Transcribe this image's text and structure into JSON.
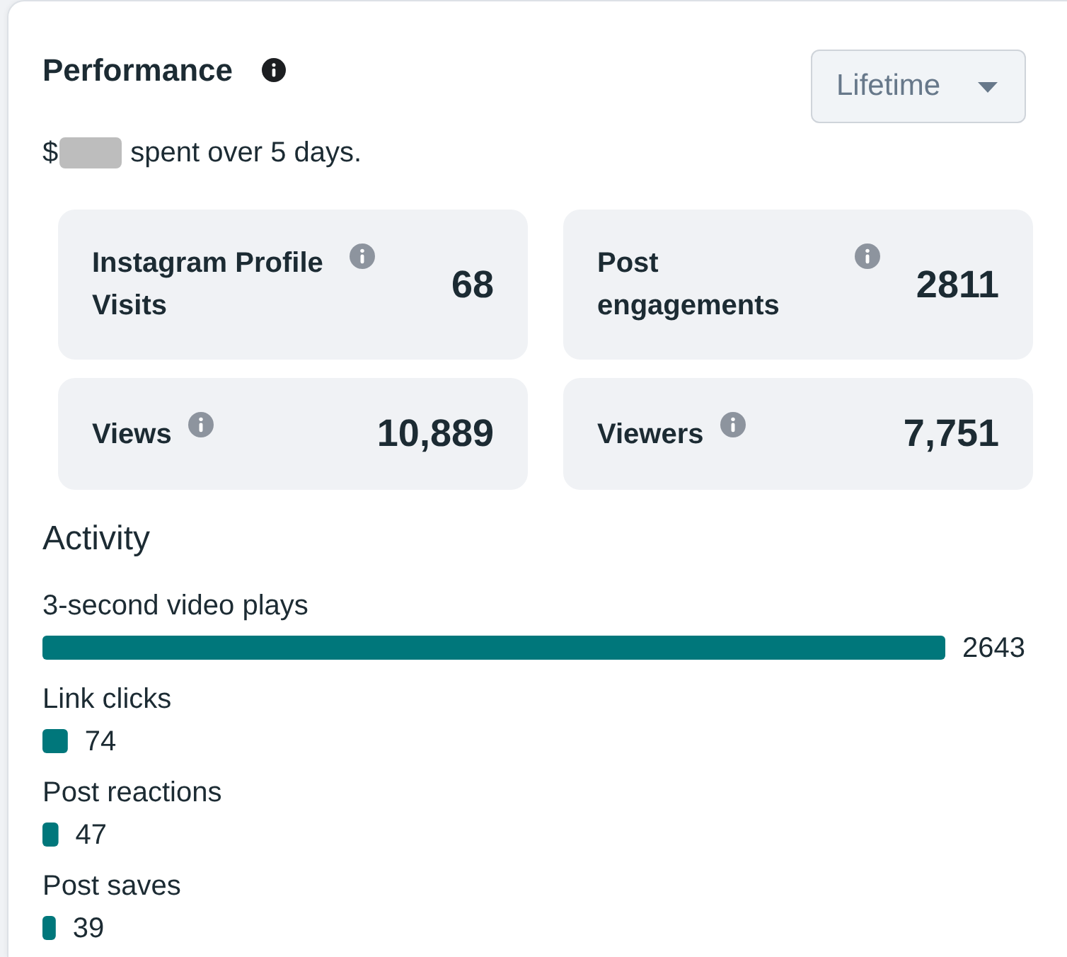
{
  "header": {
    "title": "Performance",
    "range_dropdown": {
      "value": "Lifetime"
    }
  },
  "spend_note": {
    "currency": "$",
    "amount_redacted": true,
    "text": "spent over 5 days."
  },
  "metrics": [
    {
      "label": "Instagram Profile Visits",
      "value": "68"
    },
    {
      "label": "Post engagements",
      "value": "2811"
    },
    {
      "label": "Views",
      "value": "10,889"
    },
    {
      "label": "Viewers",
      "value": "7,751"
    }
  ],
  "activity": {
    "chart_data": {
      "type": "bar",
      "orientation": "horizontal",
      "title": "Activity",
      "categories": [
        "3-second video plays",
        "Link clicks",
        "Post reactions",
        "Post saves"
      ],
      "values": [
        2643,
        74,
        47,
        39
      ],
      "data_labels": true
    }
  }
}
